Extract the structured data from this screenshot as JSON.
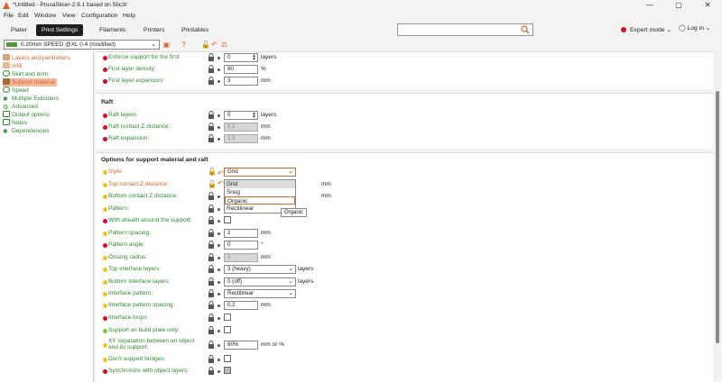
{
  "app": {
    "title": "*Untitled - PrusaSlicer-2.9.1 based on Slic3r",
    "window_controls": {
      "minimize": "—",
      "maximize": "▢",
      "close": "✕"
    }
  },
  "menu": [
    "File",
    "Edit",
    "Window",
    "View",
    "Configuration",
    "Help"
  ],
  "tabs": [
    "Plater",
    "Print Settings",
    "Filaments",
    "Printers",
    "Printables"
  ],
  "mode": {
    "label": "Expert mode",
    "color": "#e4002b"
  },
  "login": "Log in",
  "preset": {
    "name": "0.20mm SPEED @XL 0.4 (modified)"
  },
  "nav": [
    {
      "label": "Layers and perimeters",
      "icon": "layers-icon",
      "color": "#d9652a"
    },
    {
      "label": "Infill",
      "icon": "infill-icon",
      "color": "#d9652a"
    },
    {
      "label": "Skirt and brim",
      "icon": "skirt-icon",
      "color": "#2e8b2e"
    },
    {
      "label": "Support material",
      "icon": "support-icon",
      "color": "#d9652a"
    },
    {
      "label": "Speed",
      "icon": "speed-icon",
      "color": "#2e8b2e"
    },
    {
      "label": "Multiple Extruders",
      "icon": "extruders-icon",
      "color": "#2e8b2e"
    },
    {
      "label": "Advanced",
      "icon": "advanced-icon",
      "color": "#2e8b2e"
    },
    {
      "label": "Output options",
      "icon": "output-icon",
      "color": "#2e8b2e"
    },
    {
      "label": "Notes",
      "icon": "notes-icon",
      "color": "#2e8b2e"
    },
    {
      "label": "Dependencies",
      "icon": "dependencies-icon",
      "color": "#2e8b2e"
    }
  ],
  "top_rows": [
    {
      "label": "Enforce support for the first",
      "value": "0",
      "unit": "layers",
      "dot": "#e4002b"
    },
    {
      "label": "First layer density:",
      "value": "80",
      "unit": "%",
      "dot": "#e4002b"
    },
    {
      "label": "First layer expansion:",
      "value": "3",
      "unit": "mm",
      "dot": "#e4002b"
    }
  ],
  "raft": {
    "title": "Raft",
    "rows": [
      {
        "label": "Raft layers:",
        "value": "0",
        "unit": "layers",
        "dot": "#e4002b"
      },
      {
        "label": "Raft contact Z distance:",
        "value": "0.2",
        "unit": "mm",
        "dot": "#e4002b"
      },
      {
        "label": "Raft expansion:",
        "value": "1.5",
        "unit": "mm",
        "dot": "#e4002b"
      }
    ]
  },
  "options": {
    "title": "Options for support material and raft",
    "rows": [
      {
        "label": "Style:",
        "value": "Grid",
        "unit": "",
        "dot": "#f0c419"
      },
      {
        "label": "Top contact Z distance:",
        "value": "",
        "unit": "mm",
        "dot": "#f0c419"
      },
      {
        "label": "Bottom contact Z distance:",
        "value": "",
        "unit": "mm",
        "dot": "#f0c419"
      },
      {
        "label": "Pattern:",
        "value": "Rectilinear",
        "unit": "",
        "dot": "#f0c419"
      },
      {
        "label": "With sheath around the support:",
        "value": "",
        "unit": "",
        "dot": "#e4002b"
      },
      {
        "label": "Pattern spacing:",
        "value": "2",
        "unit": "mm",
        "dot": "#f0c419"
      },
      {
        "label": "Pattern angle:",
        "value": "0",
        "unit": "°",
        "dot": "#e4002b"
      },
      {
        "label": "Closing radius:",
        "value": "2",
        "unit": "mm",
        "dot": "#f0c419"
      },
      {
        "label": "Top interface layers:",
        "value": "3 (heavy)",
        "unit": "layers",
        "dot": "#f0c419"
      },
      {
        "label": "Bottom interface layers:",
        "value": "0 (off)",
        "unit": "layers",
        "dot": "#f0c419"
      },
      {
        "label": "Interface pattern:",
        "value": "Rectilinear",
        "unit": "",
        "dot": "#f0c419"
      },
      {
        "label": "Interface pattern spacing:",
        "value": "0.2",
        "unit": "mm",
        "dot": "#f0c419"
      },
      {
        "label": "Interface loops:",
        "value": "",
        "unit": "",
        "dot": "#e4002b"
      },
      {
        "label": "Support on build plate only:",
        "value": "",
        "unit": "",
        "dot": "#7ac943"
      },
      {
        "label": "XY separation between an object",
        "label2": "and its support:",
        "value": "80%",
        "unit": "mm or %",
        "dot": "#f0c419"
      },
      {
        "label": "Don't support bridges:",
        "value": "",
        "unit": "",
        "dot": "#f0c419"
      },
      {
        "label": "Synchronize with object layers:",
        "value": "",
        "unit": "",
        "dot": "#e4002b"
      }
    ]
  },
  "dropdown": {
    "items": [
      "Grid",
      "Snug",
      "Organic",
      "Rectilinear"
    ],
    "tooltip": "Organic"
  }
}
